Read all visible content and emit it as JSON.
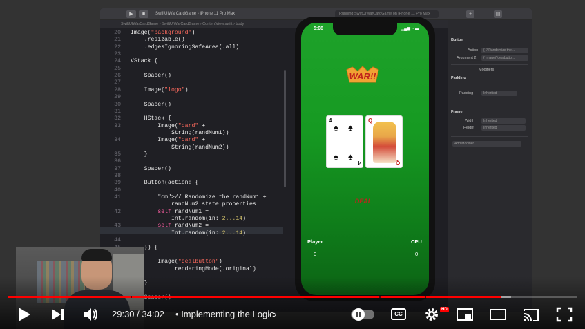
{
  "xcode": {
    "scheme": "SwiftUIWarCardGame  ›  iPhone 11 Pro Max",
    "status": "Running SwiftUIWarCardGame on iPhone 11 Pro Max",
    "jumpbar": "SwiftUIWarCardGame  ›  SwiftUIWarCardGame  ›  ContentView.swift  ›  body",
    "code_lines": [
      {
        "n": "20",
        "text": "Image(\"background\")"
      },
      {
        "n": "21",
        "text": "    .resizable()"
      },
      {
        "n": "22",
        "text": "    .edgesIgnoringSafeArea(.all)"
      },
      {
        "n": "23",
        "text": ""
      },
      {
        "n": "24",
        "text": "VStack {"
      },
      {
        "n": "25",
        "text": ""
      },
      {
        "n": "26",
        "text": "    Spacer()"
      },
      {
        "n": "27",
        "text": ""
      },
      {
        "n": "28",
        "text": "    Image(\"logo\")"
      },
      {
        "n": "29",
        "text": ""
      },
      {
        "n": "30",
        "text": "    Spacer()"
      },
      {
        "n": "31",
        "text": ""
      },
      {
        "n": "32",
        "text": "    HStack {"
      },
      {
        "n": "33",
        "text": "        Image(\"card\" +"
      },
      {
        "n": "",
        "text": "            String(randNum1))"
      },
      {
        "n": "34",
        "text": "        Image(\"card\" +"
      },
      {
        "n": "",
        "text": "            String(randNum2))"
      },
      {
        "n": "35",
        "text": "    }"
      },
      {
        "n": "36",
        "text": ""
      },
      {
        "n": "37",
        "text": "    Spacer()"
      },
      {
        "n": "38",
        "text": ""
      },
      {
        "n": "39",
        "text": "    Button(action: {"
      },
      {
        "n": "40",
        "text": ""
      },
      {
        "n": "41",
        "text": "        // Randomize the randNum1 +"
      },
      {
        "n": "",
        "text": "            randNum2 state properties"
      },
      {
        "n": "42",
        "text": "        self.randNum1 ="
      },
      {
        "n": "",
        "text": "            Int.random(in: 2...14)"
      },
      {
        "n": "43",
        "text": "        self.randNum2 ="
      },
      {
        "n": "",
        "text": "            Int.random(in: 2...14)"
      },
      {
        "n": "44",
        "text": ""
      },
      {
        "n": "45",
        "text": "    }) {"
      },
      {
        "n": "46",
        "text": ""
      },
      {
        "n": "47",
        "text": "        Image(\"dealbutton\")"
      },
      {
        "n": "",
        "text": "            .renderingMode(.original)"
      },
      {
        "n": "48",
        "text": ""
      },
      {
        "n": "49",
        "text": "    }"
      },
      {
        "n": "50",
        "text": ""
      },
      {
        "n": "51",
        "text": "    Spacer()"
      }
    ]
  },
  "inspector": {
    "section_button": "Button",
    "action_label": "Action",
    "action_value": "{ // Randomize the...",
    "argument_label": "Argument 2",
    "argument_value": "{ Image(\"dealbutto...",
    "modifiers_label": "Modifiers",
    "padding_section": "Padding",
    "padding_label": "Padding",
    "padding_value": "Inherited",
    "frame_section": "Frame",
    "width_label": "Width",
    "width_value": "Inherited",
    "height_label": "Height",
    "height_value": "Inherited",
    "add_modifier": "Add Modifier"
  },
  "simulator": {
    "time": "5:08",
    "status_icons": "▂▄▆ ◔ ▬",
    "logo_text": "WAR!!",
    "left_card_rank": "4",
    "left_card_suit": "♠",
    "right_card_rank": "Q",
    "right_card_suit": "♦",
    "deal_text": "DEAL",
    "player_label": "Player",
    "cpu_label": "CPU",
    "player_score": "0",
    "cpu_score": "0"
  },
  "player": {
    "time_current": "29:30",
    "time_total": "34:02",
    "time_display": "29:30 / 34:02",
    "chapter_separator": "•",
    "chapter_title": "Implementing the Logic",
    "progress_played_fraction": 0.8667,
    "progress_buffered_fraction": 0.885,
    "chapter_marks_fraction": [
      0.215,
      0.652,
      0.733
    ],
    "cc_label": "CC",
    "hd_badge": "HD",
    "accent_color": "#ff0000"
  }
}
